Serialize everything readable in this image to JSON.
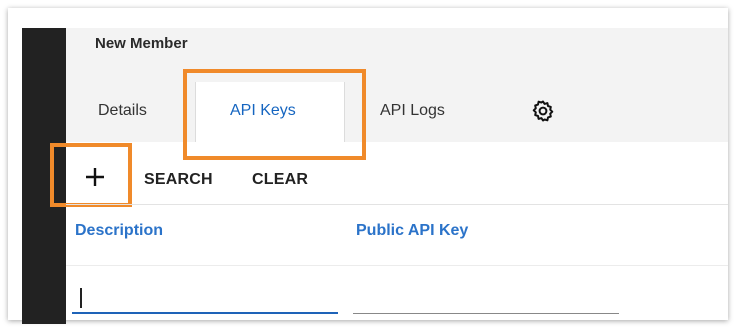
{
  "header": {
    "title": "New Member"
  },
  "tabs": [
    {
      "label": "Details",
      "active": false
    },
    {
      "label": "API Keys",
      "active": true
    },
    {
      "label": "API Logs",
      "active": false
    }
  ],
  "icons": {
    "settings": "gear-icon",
    "add": "plus-icon"
  },
  "toolbar": {
    "search_label": "SEARCH",
    "clear_label": "CLEAR"
  },
  "table": {
    "columns": [
      "Description",
      "Public API Key"
    ]
  },
  "filters": {
    "description_value": "",
    "public_api_key_value": ""
  },
  "colors": {
    "highlight": "#f08a2a",
    "accent": "#2b73c9",
    "active_tab": "#1565c0"
  }
}
